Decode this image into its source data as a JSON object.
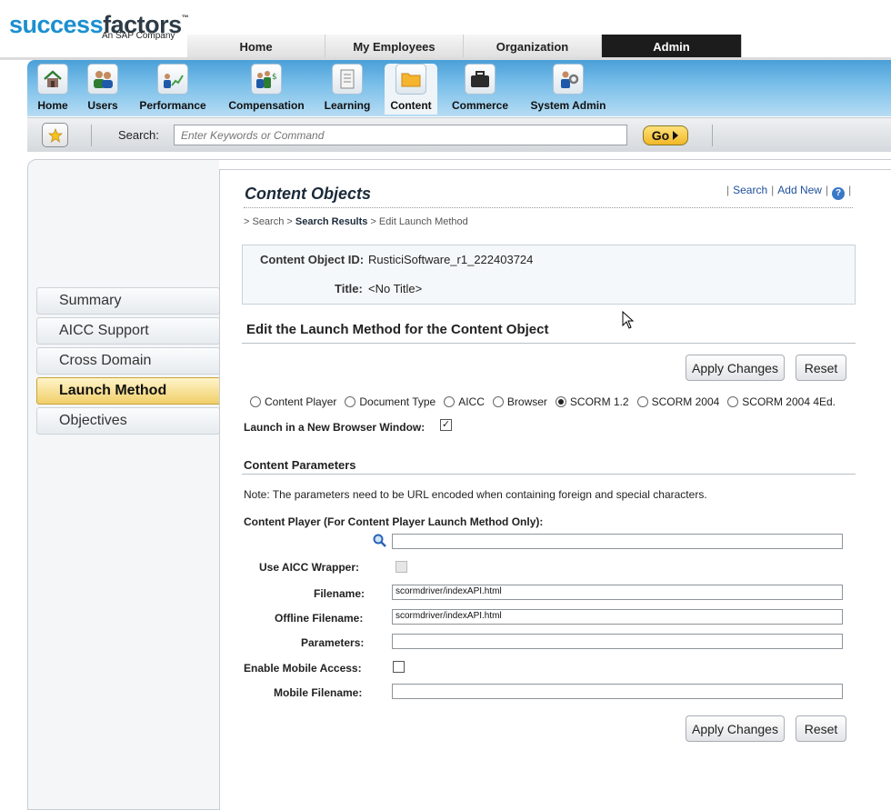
{
  "brand": {
    "word_a": "success",
    "word_b": "factors",
    "tm": "™",
    "tagline": "An SAP Company"
  },
  "top_tabs": [
    {
      "label": "Home"
    },
    {
      "label": "My Employees"
    },
    {
      "label": "Organization"
    },
    {
      "label": "Admin"
    }
  ],
  "active_top_tab": "Admin",
  "modules": [
    {
      "label": "Home",
      "icon": "house-icon"
    },
    {
      "label": "Users",
      "icon": "users-icon"
    },
    {
      "label": "Performance",
      "icon": "performance-chart-icon"
    },
    {
      "label": "Compensation",
      "icon": "compensation-icon"
    },
    {
      "label": "Learning",
      "icon": "document-icon"
    },
    {
      "label": "Content",
      "icon": "folder-icon"
    },
    {
      "label": "Commerce",
      "icon": "briefcase-icon"
    },
    {
      "label": "System Admin",
      "icon": "system-admin-icon"
    }
  ],
  "active_module": "Content",
  "search": {
    "label": "Search:",
    "placeholder": "Enter Keywords or Command",
    "go_label": "Go"
  },
  "left_nav": [
    {
      "label": "Summary"
    },
    {
      "label": "AICC Support"
    },
    {
      "label": "Cross Domain"
    },
    {
      "label": "Launch Method"
    },
    {
      "label": "Objectives"
    }
  ],
  "active_nav": "Launch Method",
  "page": {
    "title": "Content Objects",
    "links": {
      "search": "Search",
      "add_new": "Add New",
      "help": "?"
    },
    "breadcrumb": {
      "root": "> Search >",
      "results": "Search Results",
      "current": "> Edit Launch Method"
    }
  },
  "info": {
    "id_label": "Content Object ID:",
    "id_value": "RusticiSoftware_r1_222403724",
    "title_label": "Title:",
    "title_value": "<No Title>"
  },
  "edit": {
    "heading": "Edit the Launch Method for the Content Object",
    "apply_label": "Apply Changes",
    "reset_label": "Reset",
    "launch_options": [
      "Content Player",
      "Document Type",
      "AICC",
      "Browser",
      "SCORM 1.2",
      "SCORM 2004",
      "SCORM 2004 4Ed."
    ],
    "selected_option": "SCORM 1.2",
    "new_window_label": "Launch in a New Browser Window:",
    "new_window_checked": true,
    "new_window_mark": "✓"
  },
  "params": {
    "heading": "Content Parameters",
    "note": "Note: The parameters need to be URL encoded when containing foreign and special characters.",
    "player_label": "Content Player (For Content Player Launch Method Only):",
    "player_value": "",
    "aicc_wrapper_label": "Use AICC Wrapper:",
    "filename_label": "Filename:",
    "filename_value": "scormdriver/indexAPI.html",
    "offline_label": "Offline Filename:",
    "offline_value": "scormdriver/indexAPI.html",
    "parameters_label": "Parameters:",
    "parameters_value": "",
    "mobile_access_label": "Enable Mobile Access:",
    "mobile_access_checked": false,
    "mobile_filename_label": "Mobile Filename:",
    "mobile_filename_value": ""
  }
}
